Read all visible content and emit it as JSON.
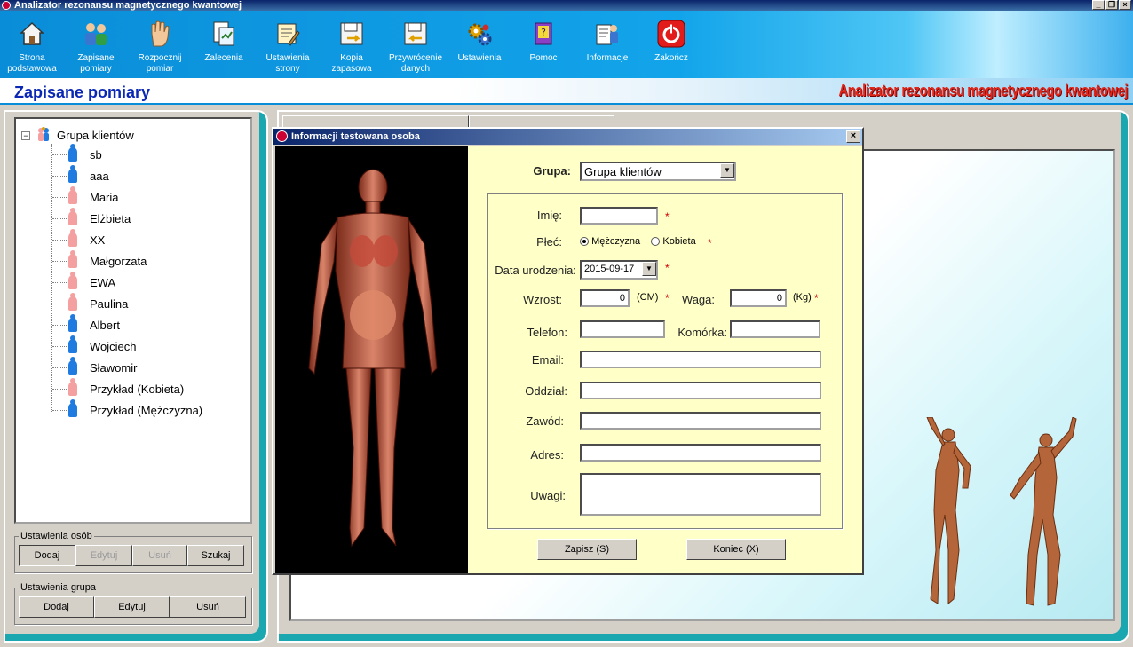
{
  "window": {
    "title": "Analizator rezonansu magnetycznego kwantowej"
  },
  "toolbar": {
    "items": [
      {
        "label": "Strona\npodstawowa",
        "icon": "home-icon"
      },
      {
        "label": "Zapisane\npomiary",
        "icon": "users-icon"
      },
      {
        "label": "Rozpocznij\npomiar",
        "icon": "hand-icon"
      },
      {
        "label": "Zalecenia",
        "icon": "recommendations-icon"
      },
      {
        "label": "Ustawienia\nstrony",
        "icon": "page-settings-icon"
      },
      {
        "label": "Kopia\nzapasowa",
        "icon": "backup-icon"
      },
      {
        "label": "Przywrócenie\ndanych",
        "icon": "restore-icon"
      },
      {
        "label": "Ustawienia",
        "icon": "settings-gears-icon"
      },
      {
        "label": "Pomoc",
        "icon": "help-book-icon"
      },
      {
        "label": "Informacje",
        "icon": "info-icon"
      },
      {
        "label": "Zakończ",
        "icon": "power-icon"
      }
    ]
  },
  "section": {
    "title": "Zapisane pomiary",
    "brand": "Analizator rezonansu magnetycznego kwantowej"
  },
  "tree": {
    "root": "Grupa klientów",
    "items": [
      {
        "name": "sb",
        "gender": "m"
      },
      {
        "name": "aaa",
        "gender": "m"
      },
      {
        "name": "Maria",
        "gender": "f"
      },
      {
        "name": "Elżbieta",
        "gender": "f"
      },
      {
        "name": "XX",
        "gender": "f"
      },
      {
        "name": "Małgorzata",
        "gender": "f"
      },
      {
        "name": "EWA",
        "gender": "f"
      },
      {
        "name": "Paulina",
        "gender": "f"
      },
      {
        "name": "Albert",
        "gender": "m"
      },
      {
        "name": "Wojciech",
        "gender": "m"
      },
      {
        "name": "Sławomir",
        "gender": "m"
      },
      {
        "name": "Przykład (Kobieta)",
        "gender": "f"
      },
      {
        "name": "Przykład (Mężczyzna)",
        "gender": "m"
      }
    ]
  },
  "person_settings": {
    "legend": "Ustawienia osób",
    "add": "Dodaj",
    "edit": "Edytuj",
    "delete": "Usuń",
    "search": "Szukaj"
  },
  "group_settings": {
    "legend": "Ustawienia grupa",
    "add": "Dodaj",
    "edit": "Edytuj",
    "delete": "Usuń"
  },
  "dialog": {
    "title": "Informacji testowana osoba",
    "group_label": "Grupa:",
    "group_value": "Grupa klientów",
    "first_name_label": "Imię:",
    "first_name_value": "",
    "gender_label": "Płeć:",
    "gender_male": "Mężczyzna",
    "gender_female": "Kobieta",
    "gender_selected": "male",
    "birthdate_label": "Data urodzenia:",
    "birthdate_value": "2015-09-17",
    "height_label": "Wzrost:",
    "height_value": "0",
    "height_unit": "(CM)",
    "weight_label": "Waga:",
    "weight_value": "0",
    "weight_unit": "(Kg)",
    "phone_label": "Telefon:",
    "mobile_label": "Komórka:",
    "email_label": "Email:",
    "department_label": "Oddział:",
    "profession_label": "Zawód:",
    "address_label": "Adres:",
    "notes_label": "Uwagi:",
    "required_mark": "*",
    "save_button": "Zapisz (S)",
    "close_button": "Koniec (X)"
  },
  "colors": {
    "toolbar": "#0a8dd8",
    "section_title": "#0b28b5",
    "brand": "#e2261a",
    "panel_accent": "#1aa7b0",
    "dialog_bg": "#ffffc8"
  }
}
